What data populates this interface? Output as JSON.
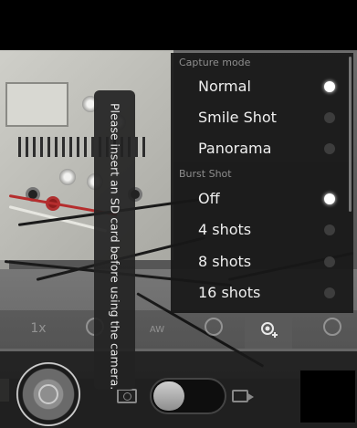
{
  "toast": {
    "message": "Please insert an SD card before using the camera."
  },
  "menu": {
    "sections": [
      {
        "title": "Capture mode",
        "options": [
          {
            "label": "Normal",
            "selected": true
          },
          {
            "label": "Smile Shot",
            "selected": false
          },
          {
            "label": "Panorama",
            "selected": false
          }
        ]
      },
      {
        "title": "Burst Shot",
        "options": [
          {
            "label": "Off",
            "selected": true
          },
          {
            "label": "4 shots",
            "selected": false
          },
          {
            "label": "8 shots",
            "selected": false
          },
          {
            "label": "16 shots",
            "selected": false
          }
        ]
      }
    ]
  },
  "settings_bar": {
    "items": [
      {
        "icon": "zoom-icon",
        "label": "1x"
      },
      {
        "icon": "flash-icon",
        "label": ""
      },
      {
        "icon": "white-balance-icon",
        "label": "AW"
      },
      {
        "icon": "scene-icon",
        "label": ""
      },
      {
        "icon": "capture-mode-icon",
        "label": "",
        "active": true
      },
      {
        "icon": "settings-icon",
        "label": ""
      }
    ]
  },
  "controls": {
    "mode": "camera",
    "shutter_icon": "shutter-icon",
    "camera_mode_icon": "camera-icon",
    "video_mode_icon": "video-icon"
  }
}
